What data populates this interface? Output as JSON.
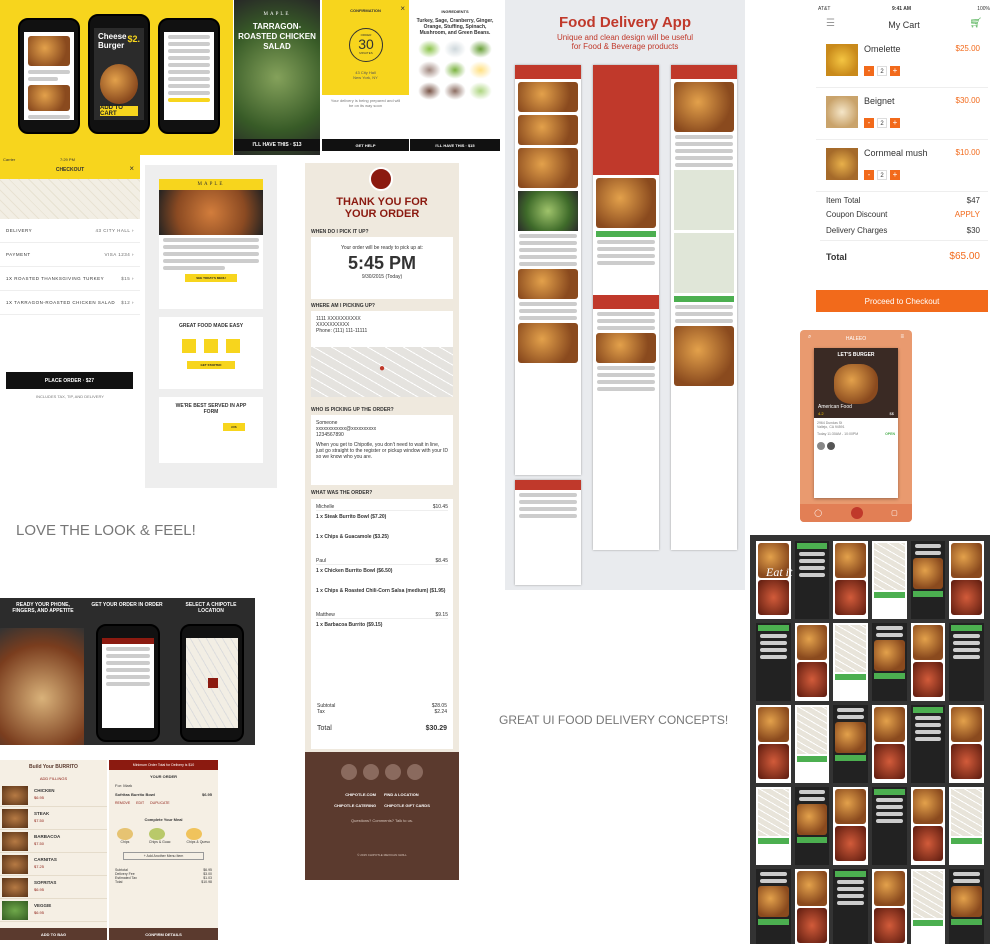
{
  "yellow_app": {
    "burger_title": "Cheese Burger",
    "price": "$2.",
    "add_btn": "ADD TO CART"
  },
  "maple_salad": {
    "brand": "MAPLE",
    "title": "TARRAGON-ROASTED CHICKEN SALAD",
    "cta": "I'LL HAVE THIS · $13"
  },
  "confirmation": {
    "header": "CONFIRMATION",
    "eta_label": "ORDER",
    "eta_value": "30",
    "eta_unit": "MINUTES",
    "address": "43 City Hall\nNew York, NY",
    "note": "Your delivery is being prepared and will be on its way soon",
    "help": "GET HELP"
  },
  "ingredients": {
    "header": "INGREDIENTS",
    "text": "Turkey, Sage, Cranberry, Ginger, Orange, Stuffing, Spinach, Mushroom, and Green Beans.",
    "items": [
      "Celery",
      "Lettuce",
      "Italian Parsley",
      "Mushroom",
      "Sage",
      "Yellow Onion"
    ],
    "cta": "I'LL HAVE THIS · $15"
  },
  "food_delivery": {
    "title": "Food Delivery App",
    "subtitle_1": "Unique and clean design will be useful",
    "subtitle_2": "for Food & Beverage products"
  },
  "my_cart": {
    "carrier": "AT&T",
    "time": "9:41 AM",
    "battery": "100%",
    "title": "My Cart",
    "items": [
      {
        "name": "Omelette",
        "price": "$25.00",
        "qty": "2"
      },
      {
        "name": "Beignet",
        "price": "$30.00",
        "qty": "2"
      },
      {
        "name": "Cornmeal mush",
        "price": "$10.00",
        "qty": "2"
      }
    ],
    "item_total_label": "Item Total",
    "item_total": "$47",
    "coupon_label": "Coupon Discount",
    "coupon_action": "APPLY",
    "delivery_label": "Delivery Charges",
    "delivery": "$30",
    "total_label": "Total",
    "total": "$65.00",
    "checkout": "Proceed to Checkout"
  },
  "checkout": {
    "carrier": "Carrier",
    "time": "7:29 PM",
    "title": "CHECKOUT",
    "rows": [
      {
        "label": "DELIVERY",
        "value": "43 CITY HALL"
      },
      {
        "label": "PAYMENT",
        "value": "VISA 1234"
      },
      {
        "label": "1X  ROASTED THANKSGIVING TURKEY",
        "value": "$15"
      },
      {
        "label": "1X  TARRAGON-ROASTED CHICKEN SALAD",
        "value": "$12"
      }
    ],
    "place_order": "PLACE ORDER · $27",
    "footer": "INCLUDES TAX, TIP, AND DELIVERY"
  },
  "maple_email": {
    "brand": "MAPLE",
    "cta1": "SEE TODAY'S MENU",
    "section2": "GREAT FOOD MADE EASY",
    "cta2": "GET STARTED",
    "section3": "WE'RE BEST SERVED IN APP FORM",
    "cta3": "iOS"
  },
  "chipotle_receipt": {
    "title_1": "THANK YOU FOR",
    "title_2": "YOUR ORDER",
    "when_label": "WHEN DO I PICK IT UP?",
    "ready_text": "Your order will be ready to pick up at:",
    "time": "5:45 PM",
    "date": "9/30/2015 (Today)",
    "where_label": "WHERE AM I PICKING UP?",
    "address_1": "1111 XXXXXXXXXX",
    "address_2": "XXXXXXXXXX",
    "phone": "Phone: (111) 111-11111",
    "who_label": "WHO IS PICKING UP THE ORDER?",
    "who_name": "Someone",
    "who_email": "xxxxxxxxxxxx@xxxxxxxxxx",
    "who_phone": "1234567890",
    "who_note": "When you get to Chipotle, you don't need to wait in line, just go straight to the register or pickup window with your ID so we know who you are.",
    "order_label": "WHAT WAS THE ORDER?",
    "people": [
      {
        "name": "Michelle",
        "amount": "$10.45",
        "line1": "1 x Steak Burrito Bowl ($7.20)",
        "line2": "1 x Chips & Guacamole ($3.25)"
      },
      {
        "name": "Paul",
        "amount": "$8.45",
        "line1": "1 x Chicken Burrito Bowl ($6.50)",
        "line2": "1 x Chips & Roasted Chili-Corn Salsa (medium) ($1.95)"
      },
      {
        "name": "Matthew",
        "amount": "$9.15",
        "line1": "1 x Barbacoa Burrito ($9.15)",
        "line2": ""
      }
    ],
    "subtotal_label": "Subtotal",
    "subtotal": "$28.05",
    "tax_label": "Tax",
    "tax": "$2.24",
    "total_label": "Total",
    "total": "$30.29",
    "footer_links": [
      "CHIPOTLE.COM",
      "FIND A LOCATION",
      "CHIPOTLE CATERING",
      "CHIPOTLE GIFT CARDS"
    ],
    "footer_q": "Questions? Comments? Talk to us.",
    "copyright": "© 2015 CHIPOTLE MEXICAN GRILL"
  },
  "burger_card": {
    "brand": "HALEEO",
    "promo": "LET'S BURGER",
    "name": "American Food",
    "rating": "4.2",
    "price": "$$",
    "address": "2964 Dundas St\nVallejo, CA 94591",
    "hours": "Today 11:30AM - 10:00PM",
    "status": "OPEN"
  },
  "captions": {
    "love": "LOVE THE LOOK & FEEL!",
    "great_ui": "GREAT UI FOOD DELIVERY CONCEPTS!"
  },
  "chipotle_promo": {
    "panel1": "READY YOUR PHONE, FINGERS, AND APPETITE",
    "panel2": "GET YOUR ORDER IN ORDER",
    "panel3": "SELECT A CHIPOTLE LOCATION"
  },
  "burrito_builder": {
    "title": "Build Your BURRITO",
    "section": "ADD FILLINGS",
    "fillings": [
      {
        "name": "CHICKEN",
        "price": "$6.95"
      },
      {
        "name": "STEAK",
        "price": "$7.50"
      },
      {
        "name": "BARBACOA",
        "price": "$7.50"
      },
      {
        "name": "CARNITAS",
        "price": "$7.25"
      },
      {
        "name": "SOFRITAS",
        "price": "$6.95"
      },
      {
        "name": "VEGGIE",
        "price": "$6.95"
      }
    ],
    "footer": "ADD TO BAG"
  },
  "your_order": {
    "banner": "Minimum Order Total for Delivery is $10",
    "title": "YOUR ORDER",
    "for_label": "For: Mark",
    "item": "Sofritas Burrito Bowl",
    "item_price": "$6.95",
    "actions": [
      "REMOVE",
      "EDIT",
      "DUPLICATE"
    ],
    "complete": "Complete Your Meal",
    "sides": [
      "Chips",
      "Chips & Guac",
      "Chips & Queso"
    ],
    "add_more": "+ Add Another Menu Item",
    "totals": [
      [
        "Subtotal",
        "$6.95"
      ],
      [
        "Delivery Fee",
        "$3.00"
      ],
      [
        "Estimated Tax",
        "$1.03"
      ],
      [
        "Total",
        "$10.98"
      ]
    ],
    "cta": "CONFIRM DETAILS"
  },
  "eat_it": {
    "logo": "Eat it"
  },
  "colors": {
    "yellow": "#f7d51d",
    "cart_orange": "#f26a1b",
    "chipotle_red": "#8b1a10",
    "chipotle_brown": "#5b3a2e",
    "delivery_red": "#c0392b",
    "eatit_green": "#4caf50"
  }
}
